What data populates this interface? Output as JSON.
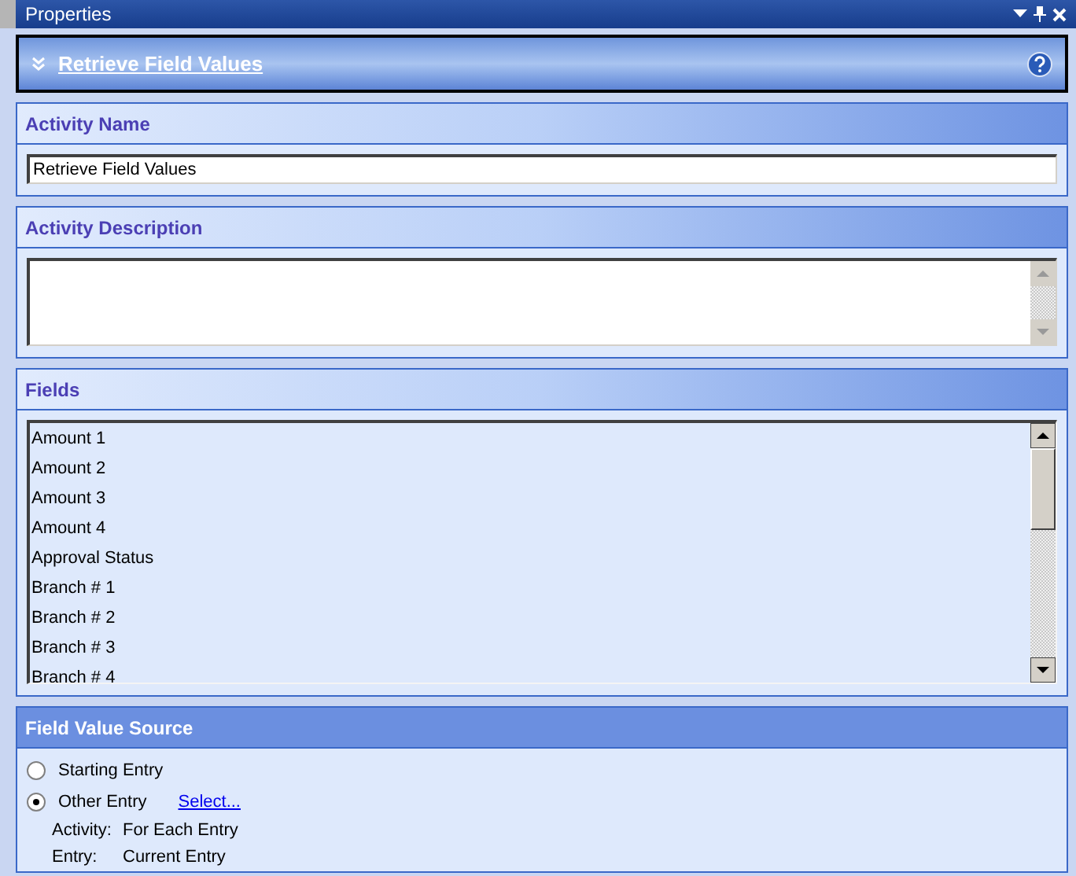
{
  "window": {
    "title": "Properties"
  },
  "header": {
    "title": "Retrieve Field Values"
  },
  "sections": [
    {
      "kind": "name",
      "title": "Activity Name",
      "active": false,
      "value": "Retrieve Field Values"
    },
    {
      "kind": "description",
      "title": "Activity Description",
      "active": false
    },
    {
      "kind": "list",
      "title": "Fields",
      "active": false,
      "items": [
        "Amount 1",
        "Amount 2",
        "Amount 3",
        "Amount 4",
        "Approval Status",
        "Branch # 1",
        "Branch # 2",
        "Branch # 3",
        "Branch # 4"
      ]
    },
    {
      "kind": "source",
      "title": "Field Value Source",
      "active": true,
      "options": [
        {
          "label": "Starting Entry",
          "selected": false
        },
        {
          "label": "Other Entry",
          "selected": true,
          "link": "Select..."
        }
      ],
      "details": [
        {
          "label": "Activity:",
          "value": "For Each Entry"
        },
        {
          "label": "Entry:",
          "value": "Current Entry"
        }
      ]
    }
  ]
}
